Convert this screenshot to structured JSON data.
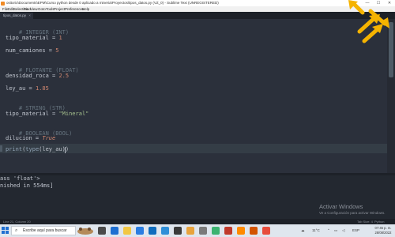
{
  "window": {
    "title": "ositorio\\Documents\\EPM\\Curso python desde 0 aplicado a mineria\\Proyectos\\tipos_datos.py (VZ_0) - Sublime Text (UNREGISTERED)",
    "minimize": "—",
    "maximize": "☐",
    "close": "✕"
  },
  "menu": [
    "File",
    "Edit",
    "Selection",
    "Find",
    "View",
    "Goto",
    "Tools",
    "Project",
    "Preferences",
    "Help"
  ],
  "tab": {
    "label": "tipos_datos.py",
    "close": "×"
  },
  "code": [
    {
      "kind": "comment",
      "text": "# INTEGER (INT)"
    },
    {
      "kind": "assign",
      "name": "tipo_material",
      "op": " = ",
      "value": "1",
      "vtype": "num"
    },
    {
      "kind": "assign",
      "name": "num_camiones",
      "op": " = ",
      "value": "5",
      "vtype": "num"
    },
    {
      "kind": "comment",
      "text": "# FLOTANTE (FLOAT)"
    },
    {
      "kind": "assign",
      "name": "densidad_roca",
      "op": " = ",
      "value": "2.5",
      "vtype": "num"
    },
    {
      "kind": "assign",
      "name": "ley_au",
      "op": " = ",
      "value": "1.85",
      "vtype": "num"
    },
    {
      "kind": "comment",
      "text": "# STRING (STR)"
    },
    {
      "kind": "assign",
      "name": "tipo_material",
      "op": " = ",
      "value": "\"Mineral\"",
      "vtype": "str"
    },
    {
      "kind": "comment",
      "text": "# BOOLEAN (BOOL)"
    },
    {
      "kind": "assign",
      "name": "dilucion",
      "op": " = ",
      "value": "True",
      "vtype": "bool"
    },
    {
      "kind": "call",
      "fn1": "print",
      "p1": "(",
      "fn2": "type",
      "p2": "(",
      "arg": "ley_au",
      "close": "))"
    }
  ],
  "console": {
    "lines": [
      "ass 'float'>",
      "nished in 554ms]"
    ]
  },
  "watermark": {
    "title": "Activar Windows",
    "subtitle": "Ve a Configuración para activar Windows."
  },
  "status": {
    "position": "Line 21, Column 20",
    "tab_size": "Tab Size: 4",
    "syntax": "Python"
  },
  "taskbar": {
    "search_placeholder": "Escribe aquí para buscar",
    "weather": "11°C",
    "language": "ESP",
    "time": "07:45 p. m.",
    "date": "28/08/2022"
  },
  "colors": {
    "editor_bg": "#2b303b",
    "comment": "#65737e",
    "number": "#d08770",
    "string": "#a3be8c",
    "function": "#8fa1b3",
    "overlay_arrows": "#f5b300"
  }
}
